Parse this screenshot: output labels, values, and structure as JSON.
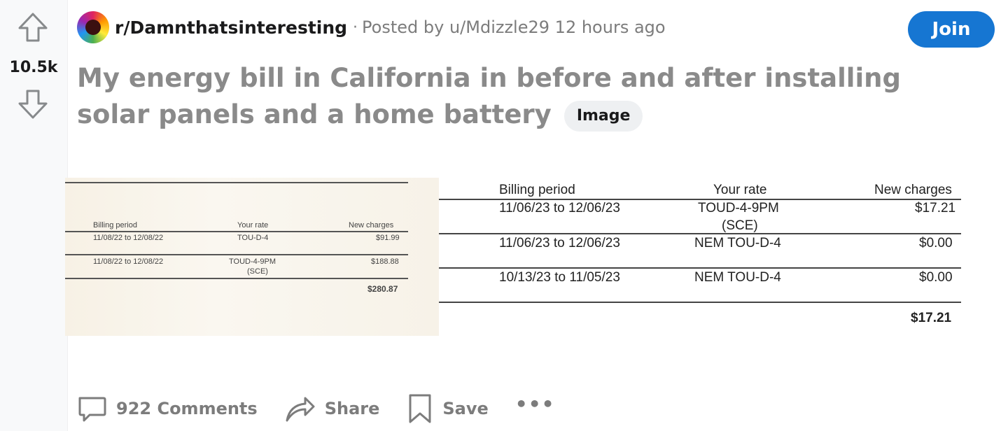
{
  "post": {
    "score": "10.5k",
    "subreddit": "r/Damnthatsinteresting",
    "separator": "·",
    "posted_by_prefix": "Posted by ",
    "author": "u/Mdizzle29",
    "age": "12 hours ago",
    "join_label": "Join",
    "title": "My energy bill in California in before and after installing solar panels and a home battery",
    "flair": "Image"
  },
  "image_old_bill": {
    "headers": [
      "Billing period",
      "Your rate",
      "New charges"
    ],
    "rows": [
      {
        "period": "11/08/22 to 12/08/22",
        "rate": "TOU-D-4",
        "rate2": "",
        "charge": "$91.99"
      },
      {
        "period": "11/08/22 to 12/08/22",
        "rate": "TOUD-4-9PM",
        "rate2": "(SCE)",
        "charge": "$188.88"
      }
    ],
    "total": "$280.87"
  },
  "image_new_bill": {
    "headers": [
      "Billing period",
      "Your rate",
      "New charges"
    ],
    "rows": [
      {
        "period": "11/06/23 to 12/06/23",
        "rate": "TOUD-4-9PM",
        "rate2": "(SCE)",
        "charge": "$17.21"
      },
      {
        "period": "11/06/23 to 12/06/23",
        "rate": "NEM TOU-D-4",
        "rate2": "",
        "charge": "$0.00"
      },
      {
        "period": "10/13/23 to 11/05/23",
        "rate": "NEM TOU-D-4",
        "rate2": "",
        "charge": "$0.00"
      }
    ],
    "total": "$17.21"
  },
  "actions": {
    "comments": "922 Comments",
    "share": "Share",
    "save": "Save",
    "more": "•••"
  },
  "icons": {
    "upvote": "upvote-arrow-icon",
    "downvote": "downvote-arrow-icon",
    "comment": "comment-bubble-icon",
    "share": "share-arrow-icon",
    "save": "bookmark-icon"
  },
  "colors": {
    "join_button": "#1676d2",
    "muted_text": "#7c7c7c",
    "title_text": "#8a8a8a"
  }
}
